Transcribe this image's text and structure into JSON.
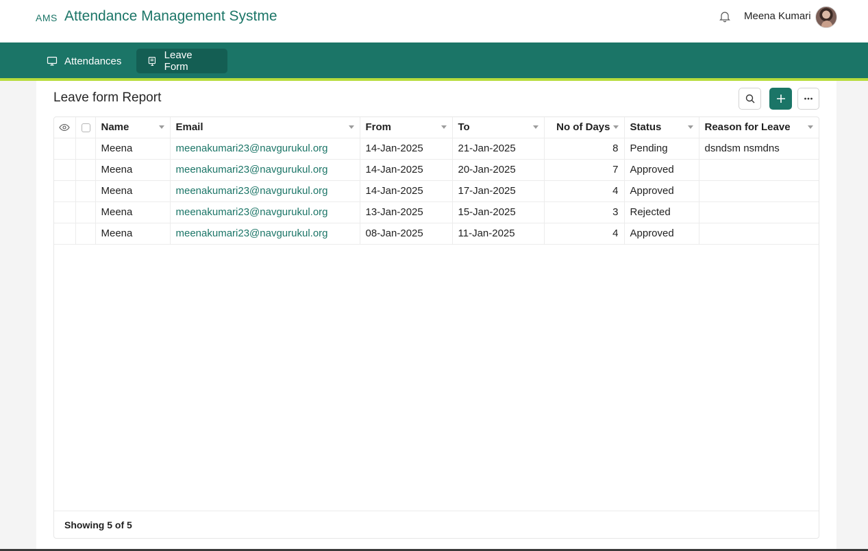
{
  "header": {
    "brand_abbr": "AMS",
    "app_title": "Attendance Management Systme",
    "user_name": "Meena Kumari",
    "icons": [
      "bell-icon",
      "avatar"
    ]
  },
  "nav": {
    "items": [
      {
        "label": "Attendances",
        "icon": "monitor-icon",
        "active": false
      },
      {
        "label": "Leave Form",
        "icon": "form-icon",
        "active": true
      }
    ]
  },
  "report": {
    "title": "Leave form Report",
    "actions": [
      "search-icon",
      "plus-icon",
      "more-icon"
    ],
    "columns": [
      "Name",
      "Email",
      "From",
      "To",
      "No of Days",
      "Status",
      "Reason for Leave"
    ],
    "rows": [
      {
        "name": "Meena",
        "email": "meenakumari23@navgurukul.org",
        "from": "14-Jan-2025",
        "to": "21-Jan-2025",
        "days": "8",
        "status": "Pending",
        "reason": "dsndsm nsmdns"
      },
      {
        "name": "Meena",
        "email": "meenakumari23@navgurukul.org",
        "from": "14-Jan-2025",
        "to": "20-Jan-2025",
        "days": "7",
        "status": "Approved",
        "reason": ""
      },
      {
        "name": "Meena",
        "email": "meenakumari23@navgurukul.org",
        "from": "14-Jan-2025",
        "to": "17-Jan-2025",
        "days": "4",
        "status": "Approved",
        "reason": ""
      },
      {
        "name": "Meena",
        "email": "meenakumari23@navgurukul.org",
        "from": "13-Jan-2025",
        "to": "15-Jan-2025",
        "days": "3",
        "status": "Rejected",
        "reason": ""
      },
      {
        "name": "Meena",
        "email": "meenakumari23@navgurukul.org",
        "from": "08-Jan-2025",
        "to": "11-Jan-2025",
        "days": "4",
        "status": "Approved",
        "reason": ""
      }
    ],
    "footer": "Showing 5 of 5"
  },
  "colors": {
    "primary": "#1b7567",
    "accent": "#b7dc3c",
    "nav_active": "#145e53"
  }
}
